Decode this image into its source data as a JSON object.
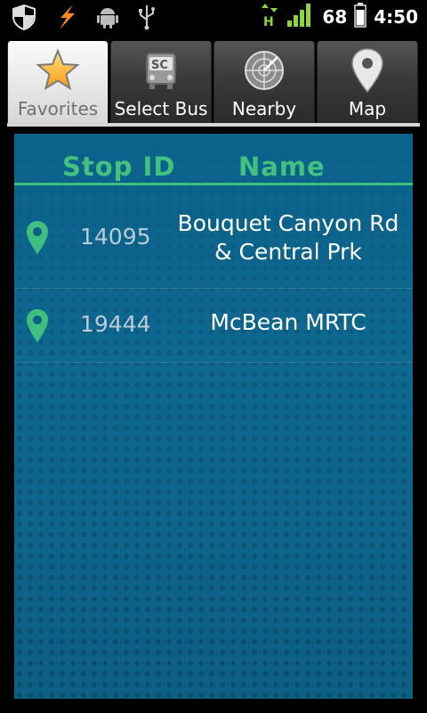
{
  "status_bar": {
    "battery_level": "68",
    "time": "4:50",
    "network_type": "H",
    "icons": [
      "shield-icon",
      "lightning-icon",
      "android-icon",
      "usb-icon",
      "data-arrows-icon",
      "signal-icon",
      "battery-icon"
    ]
  },
  "tabs": [
    {
      "label": "Favorites",
      "icon": "star-icon",
      "active": true
    },
    {
      "label": "Select Bus",
      "icon": "bus-icon",
      "active": false
    },
    {
      "label": "Nearby",
      "icon": "radar-icon",
      "active": false
    },
    {
      "label": "Map",
      "icon": "map-pin-icon",
      "active": false
    }
  ],
  "favorites": {
    "headers": {
      "stop_id": "Stop ID",
      "name": "Name"
    },
    "rows": [
      {
        "stop_id": "14095",
        "name_line1": "Bouquet Canyon Rd",
        "name_line2": "& Central Prk"
      },
      {
        "stop_id": "19444",
        "name_line1": "McBean MRTC",
        "name_line2": ""
      }
    ]
  },
  "colors": {
    "accent_green": "#43c17e",
    "panel_blue": "#0d5f83"
  }
}
